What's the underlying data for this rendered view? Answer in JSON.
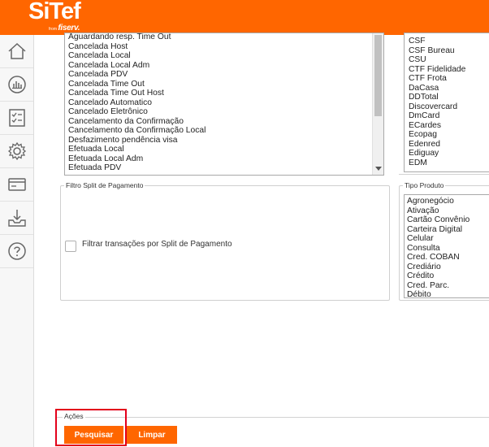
{
  "header": {
    "logo": "SiTef",
    "logo_from": "from",
    "logo_brand": "fiserv."
  },
  "sidebar": {
    "items": [
      {
        "name": "home-icon"
      },
      {
        "name": "chart-icon"
      },
      {
        "name": "checklist-icon"
      },
      {
        "name": "gear-icon"
      },
      {
        "name": "card-icon"
      },
      {
        "name": "inbox-download-icon"
      },
      {
        "name": "help-icon"
      }
    ]
  },
  "status_list": {
    "items": [
      "Aguardando resp. Time Out",
      "Cancelada Host",
      "Cancelada Local",
      "Cancelada Local Adm",
      "Cancelada PDV",
      "Cancelada Time Out",
      "Cancelada Time Out Host",
      "Cancelado Automatico",
      "Cancelado Eletrônico",
      "Cancelamento da Confirmação",
      "Cancelamento da Confirmação Local",
      "Desfazimento pendência visa",
      "Efetuada Local",
      "Efetuada Local Adm",
      "Efetuada PDV"
    ]
  },
  "network_list": {
    "items": [
      "CSF",
      "CSF Bureau",
      "CSU",
      "CTF Fidelidade",
      "CTF Frota",
      "DaCasa",
      "DDTotal",
      "Discovercard",
      "DmCard",
      "ECardes",
      "Ecopag",
      "Edenred",
      "Ediguay",
      "EDM"
    ]
  },
  "split_filter": {
    "legend": "Filtro Split de Pagamento",
    "checkbox_label": "Filtrar transações por Split de Pagamento"
  },
  "product_type": {
    "legend": "Tipo Produto",
    "items": [
      "Agronegócio",
      "Ativação",
      "Cartão Convênio",
      "Carteira Digital",
      "Celular",
      "Consulta",
      "Cred. COBAN",
      "Crediário",
      "Crédito",
      "Cred. Parc.",
      "Débito"
    ]
  },
  "actions": {
    "legend": "Ações",
    "search_label": "Pesquisar",
    "clear_label": "Limpar"
  },
  "colors": {
    "brand": "#ff6600",
    "highlight": "#e3001b"
  }
}
